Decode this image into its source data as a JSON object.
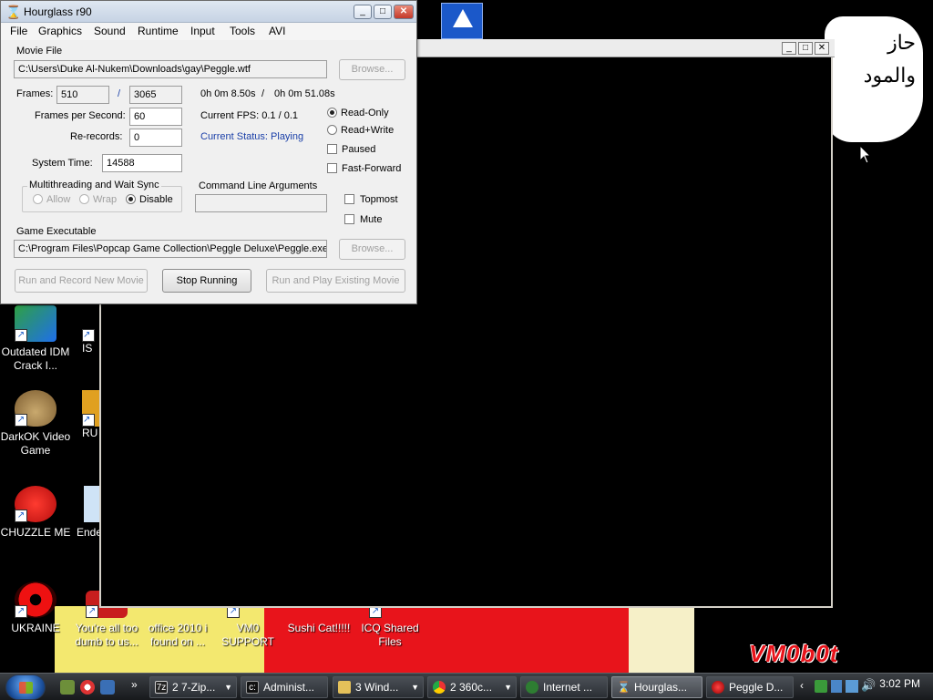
{
  "hourglass": {
    "title": "Hourglass r90",
    "menu": [
      "File",
      "Graphics",
      "Sound",
      "Runtime",
      "Input",
      "Tools",
      "AVI"
    ],
    "movie_file_label": "Movie File",
    "movie_file_path": "C:\\Users\\Duke Al-Nukem\\Downloads\\gay\\Peggle.wtf",
    "browse_label": "Browse...",
    "frames_label": "Frames:",
    "frames_current": "510",
    "frames_sep": "/",
    "frames_total": "3065",
    "time_current": "0h 0m 8.50s",
    "time_sep": "/",
    "time_total": "0h 0m 51.08s",
    "fps_label": "Frames per Second:",
    "fps_value": "60",
    "current_fps": "Current FPS: 0.1 / 0.1",
    "rerecords_label": "Re-records:",
    "rerecords_value": "0",
    "status": "Current Status: Playing",
    "read_only": "Read-Only",
    "read_write": "Read+Write",
    "paused": "Paused",
    "fast_forward": "Fast-Forward",
    "system_time_label": "System Time:",
    "system_time_value": "14588",
    "multithreading_label": "Multithreading and Wait Sync",
    "allow": "Allow",
    "wrap": "Wrap",
    "disable": "Disable",
    "cmdline_label": "Command Line Arguments",
    "cmdline_value": "",
    "topmost": "Topmost",
    "mute": "Mute",
    "game_exe_label": "Game Executable",
    "game_exe_path": "C:\\Program Files\\Popcap Game Collection\\Peggle Deluxe\\Peggle.exe",
    "run_record": "Run and Record New Movie",
    "stop_running": "Stop Running",
    "run_play": "Run and Play Existing Movie"
  },
  "desktop_icons": [
    {
      "label": "Outdated IDM Crack I..."
    },
    {
      "label": "IS"
    },
    {
      "label": "DarkOK Video Game"
    },
    {
      "label": "RU"
    },
    {
      "label": "CHUZZLE ME"
    },
    {
      "label": "Ende"
    },
    {
      "label": "UKRAINE"
    },
    {
      "label": "You're all too dumb to us..."
    },
    {
      "label": "office 2010 i found on ..."
    },
    {
      "label": "VM0 SUPPORT"
    },
    {
      "label": "Sushi Cat!!!!!"
    },
    {
      "label": "ICQ Shared Files"
    }
  ],
  "wallpaper": {
    "arabic_line1": "حاز",
    "arabic_line2": "والمود",
    "tag": "VM0b0t"
  },
  "taskbar": {
    "items": [
      {
        "label": "2 7-Zip..."
      },
      {
        "label": "Administ..."
      },
      {
        "label": "3 Wind..."
      },
      {
        "label": "2 360c..."
      },
      {
        "label": "Internet ..."
      },
      {
        "label": "Hourglas..."
      },
      {
        "label": "Peggle D..."
      }
    ],
    "clock": "3:02 PM"
  }
}
